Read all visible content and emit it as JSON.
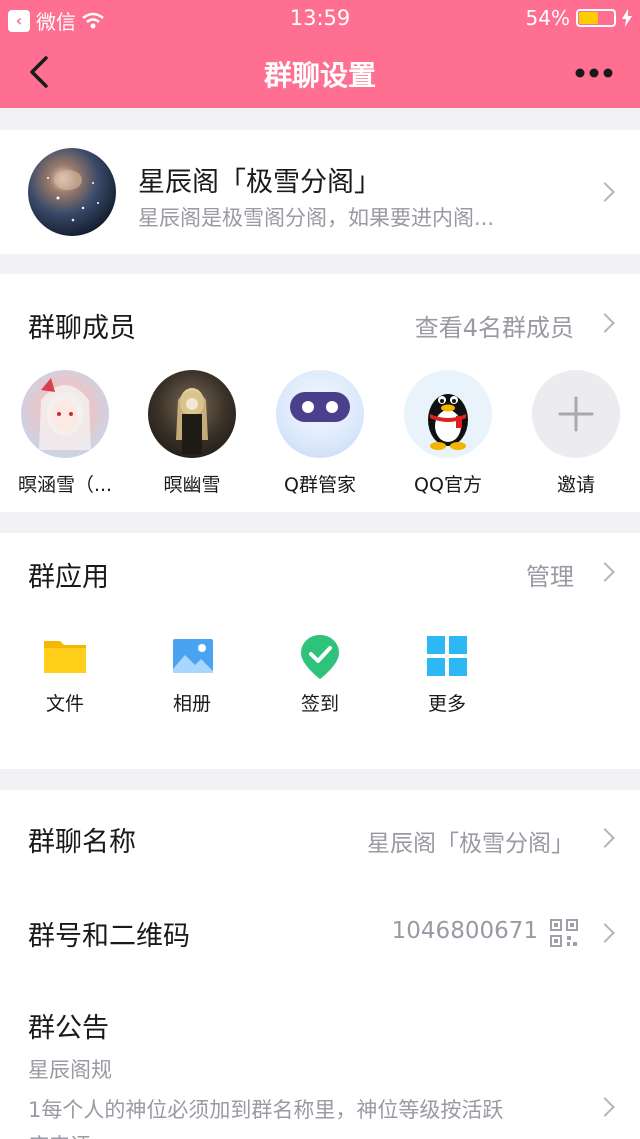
{
  "status_bar": {
    "carrier": "微信",
    "time": "13:59",
    "battery": "54%",
    "battery_level": 0.54
  },
  "nav": {
    "title": "群聊设置"
  },
  "group": {
    "name": "星辰阁「极雪分阁」",
    "description": "星辰阁是极雪阁分阁，如果要进内阁..."
  },
  "members": {
    "title": "群聊成员",
    "view_all": "查看4名群成员",
    "list": [
      {
        "name": "暝涵雪（..."
      },
      {
        "name": "暝幽雪"
      },
      {
        "name": "Q群管家"
      },
      {
        "name": "QQ官方"
      }
    ],
    "invite_label": "邀请"
  },
  "apps": {
    "title": "群应用",
    "manage": "管理",
    "items": [
      {
        "label": "文件",
        "icon": "folder-icon"
      },
      {
        "label": "相册",
        "icon": "photo-album-icon"
      },
      {
        "label": "签到",
        "icon": "check-in-icon"
      },
      {
        "label": "更多",
        "icon": "grid-more-icon"
      }
    ]
  },
  "settings": {
    "name_label": "群聊名称",
    "name_value": "星辰阁「极雪分阁」",
    "number_label": "群号和二维码",
    "number_value": "1046800671",
    "notice_label": "群公告",
    "notice_line1": "星辰阁规",
    "notice_line2": "1每个人的神位必须加到群名称里，神位等级按活跃",
    "notice_line3": "度来评"
  },
  "colors": {
    "accent": "#ff6f91",
    "secondary_text": "#999aa3"
  }
}
